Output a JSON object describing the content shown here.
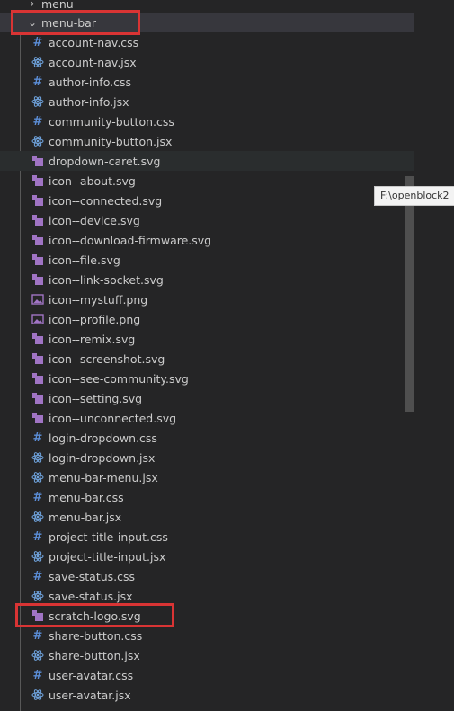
{
  "explorer": {
    "parent_folder": {
      "label": "menu",
      "expanded": false
    },
    "folder": {
      "label": "menu-bar",
      "expanded": true
    },
    "files": [
      {
        "name": "account-nav.css",
        "type": "css"
      },
      {
        "name": "account-nav.jsx",
        "type": "jsx"
      },
      {
        "name": "author-info.css",
        "type": "css"
      },
      {
        "name": "author-info.jsx",
        "type": "jsx"
      },
      {
        "name": "community-button.css",
        "type": "css"
      },
      {
        "name": "community-button.jsx",
        "type": "jsx"
      },
      {
        "name": "dropdown-caret.svg",
        "type": "svg"
      },
      {
        "name": "icon--about.svg",
        "type": "svg"
      },
      {
        "name": "icon--connected.svg",
        "type": "svg"
      },
      {
        "name": "icon--device.svg",
        "type": "svg"
      },
      {
        "name": "icon--download-firmware.svg",
        "type": "svg"
      },
      {
        "name": "icon--file.svg",
        "type": "svg"
      },
      {
        "name": "icon--link-socket.svg",
        "type": "svg"
      },
      {
        "name": "icon--mystuff.png",
        "type": "png"
      },
      {
        "name": "icon--profile.png",
        "type": "png"
      },
      {
        "name": "icon--remix.svg",
        "type": "svg"
      },
      {
        "name": "icon--screenshot.svg",
        "type": "svg"
      },
      {
        "name": "icon--see-community.svg",
        "type": "svg"
      },
      {
        "name": "icon--setting.svg",
        "type": "svg"
      },
      {
        "name": "icon--unconnected.svg",
        "type": "svg"
      },
      {
        "name": "login-dropdown.css",
        "type": "css"
      },
      {
        "name": "login-dropdown.jsx",
        "type": "jsx"
      },
      {
        "name": "menu-bar-menu.jsx",
        "type": "jsx"
      },
      {
        "name": "menu-bar.css",
        "type": "css"
      },
      {
        "name": "menu-bar.jsx",
        "type": "jsx"
      },
      {
        "name": "project-title-input.css",
        "type": "css"
      },
      {
        "name": "project-title-input.jsx",
        "type": "jsx"
      },
      {
        "name": "save-status.css",
        "type": "css"
      },
      {
        "name": "save-status.jsx",
        "type": "jsx"
      },
      {
        "name": "scratch-logo.svg",
        "type": "svg"
      },
      {
        "name": "share-button.css",
        "type": "css"
      },
      {
        "name": "share-button.jsx",
        "type": "jsx"
      },
      {
        "name": "user-avatar.css",
        "type": "css"
      },
      {
        "name": "user-avatar.jsx",
        "type": "jsx"
      }
    ]
  },
  "tooltip": {
    "text": "F:\\openblock2"
  },
  "colors": {
    "background": "#252526",
    "selected_row": "#37373d",
    "hovered_row": "#2a2d2e",
    "text": "#cccccc",
    "css_icon": "#5b8dd6",
    "react_icon": "#6fa3dd",
    "svg_icon": "#a074c4",
    "png_icon": "#a074c4",
    "highlight_box": "#d93434"
  },
  "icons": {
    "css": "hash-icon",
    "jsx": "react-icon",
    "svg": "svg-file-icon",
    "png": "image-file-icon",
    "collapsed": "chevron-right-icon",
    "expanded": "chevron-down-icon"
  }
}
